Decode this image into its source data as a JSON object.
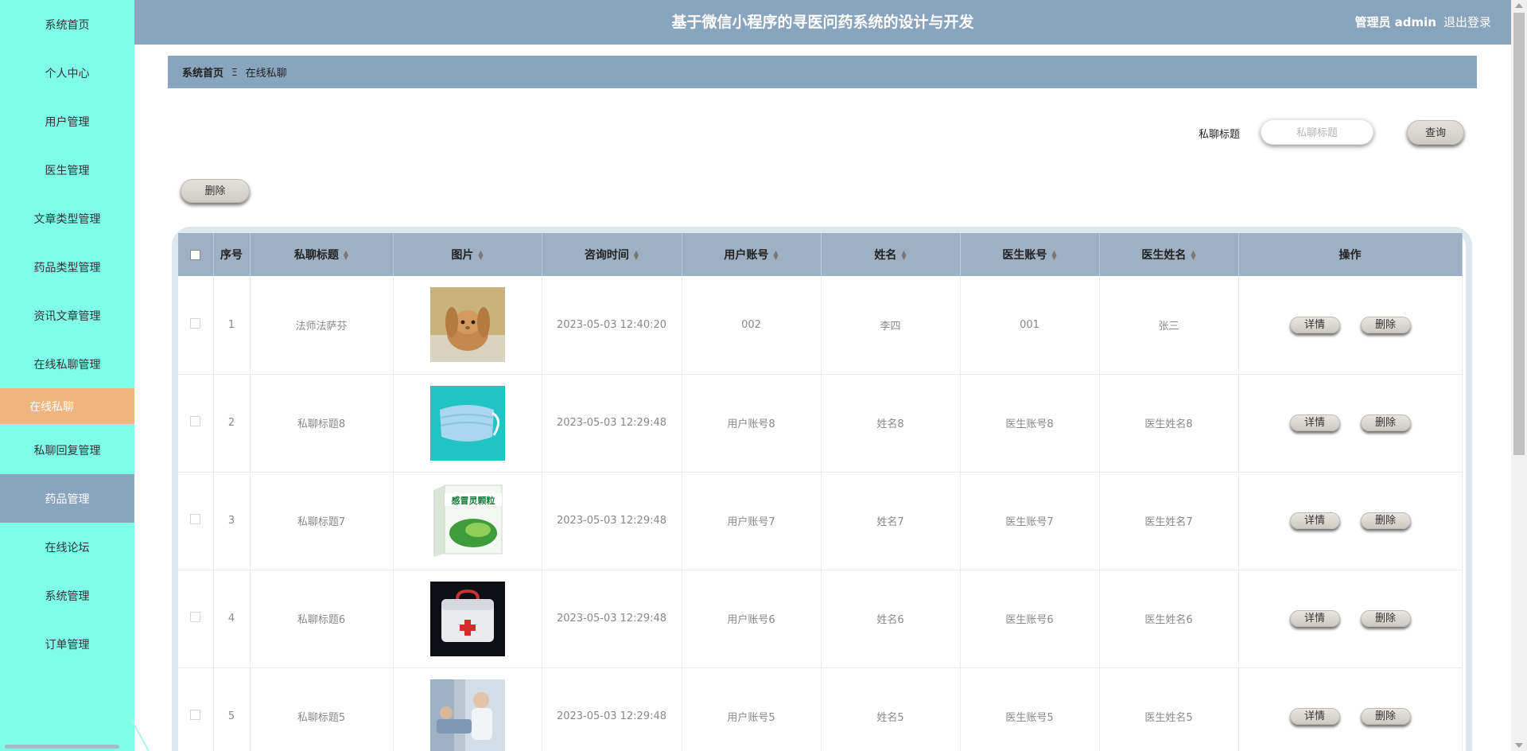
{
  "header": {
    "title": "基于微信小程序的寻医问药系统的设计与开发",
    "user": "管理员 admin",
    "logout": "退出登录"
  },
  "sidebar": {
    "items": [
      {
        "label": "系统首页"
      },
      {
        "label": "个人中心"
      },
      {
        "label": "用户管理"
      },
      {
        "label": "医生管理"
      },
      {
        "label": "文章类型管理"
      },
      {
        "label": "药品类型管理"
      },
      {
        "label": "资讯文章管理"
      },
      {
        "label": "在线私聊管理"
      },
      {
        "label": "在线私聊"
      },
      {
        "label": "私聊回复管理"
      },
      {
        "label": "药品管理"
      },
      {
        "label": "在线论坛"
      },
      {
        "label": "系统管理"
      },
      {
        "label": "订单管理"
      }
    ]
  },
  "breadcrumb": {
    "home": "系统首页",
    "separator": "Ξ",
    "current": "在线私聊"
  },
  "search": {
    "label": "私聊标题",
    "placeholder": "私聊标题",
    "value": "",
    "button": "查询"
  },
  "actions": {
    "delete": "删除"
  },
  "table": {
    "columns": [
      "序号",
      "私聊标题",
      "图片",
      "咨询时间",
      "用户账号",
      "姓名",
      "医生账号",
      "医生姓名",
      "操作"
    ],
    "rows": [
      {
        "index": "1",
        "title": "法师法萨芬",
        "image": "rabbit",
        "time": "2023-05-03 12:40:20",
        "user_account": "002",
        "name": "李四",
        "doctor_account": "001",
        "doctor_name": "张三"
      },
      {
        "index": "2",
        "title": "私聊标题8",
        "image": "face-mask",
        "time": "2023-05-03 12:29:48",
        "user_account": "用户账号8",
        "name": "姓名8",
        "doctor_account": "医生账号8",
        "doctor_name": "医生姓名8"
      },
      {
        "index": "3",
        "title": "私聊标题7",
        "image": "medicine-box",
        "time": "2023-05-03 12:29:48",
        "user_account": "用户账号7",
        "name": "姓名7",
        "doctor_account": "医生账号7",
        "doctor_name": "医生姓名7"
      },
      {
        "index": "4",
        "title": "私聊标题6",
        "image": "first-aid-kit",
        "time": "2023-05-03 12:29:48",
        "user_account": "用户账号6",
        "name": "姓名6",
        "doctor_account": "医生账号6",
        "doctor_name": "医生姓名6"
      },
      {
        "index": "5",
        "title": "私聊标题5",
        "image": "hospital-scene",
        "time": "2023-05-03 12:29:48",
        "user_account": "用户账号5",
        "name": "姓名5",
        "doctor_account": "医生账号5",
        "doctor_name": "医生姓名5"
      }
    ],
    "row_actions": {
      "detail": "详情",
      "delete": "删除"
    }
  },
  "colors": {
    "sidebar_bg": "#7ffde9",
    "header_bg": "#89a4bd",
    "active_item": "#f0b57f",
    "table_header": "#9db0c4"
  },
  "box_label": "感冒灵颗粒"
}
